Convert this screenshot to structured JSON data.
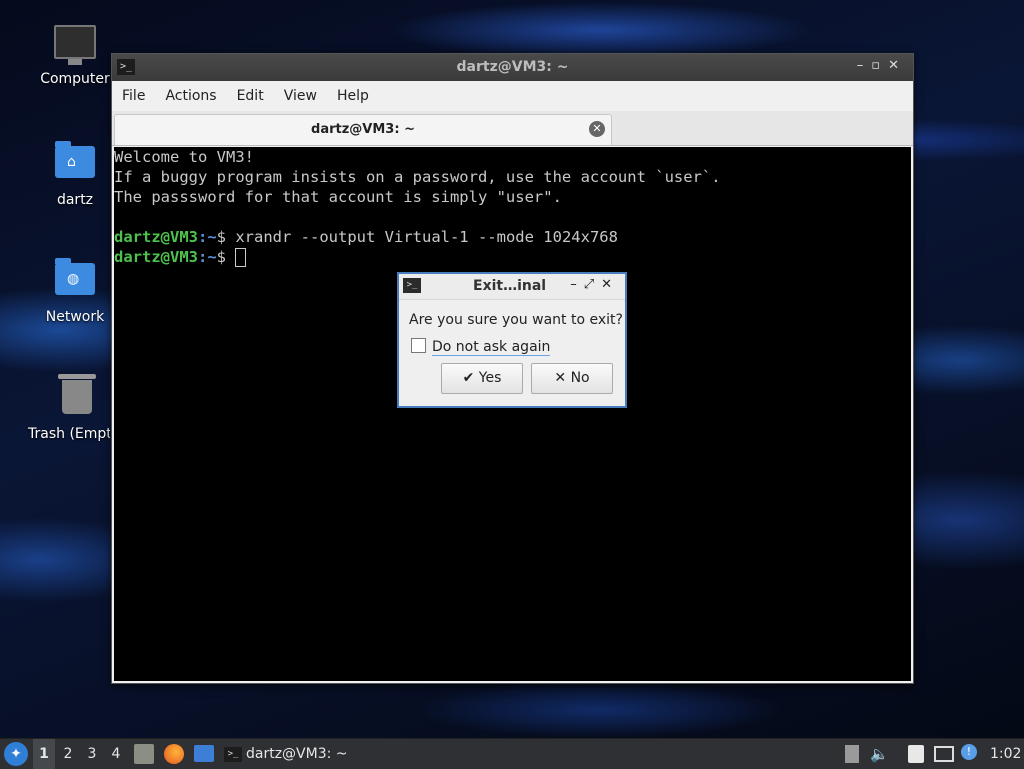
{
  "desktop": {
    "icons": [
      {
        "label": "Computer"
      },
      {
        "label": "dartz"
      },
      {
        "label": "Network"
      },
      {
        "label": "Trash (Empty)"
      }
    ]
  },
  "terminal_window": {
    "title": "dartz@VM3: ~",
    "menu": [
      "File",
      "Actions",
      "Edit",
      "View",
      "Help"
    ],
    "tab_title": "dartz@VM3: ~",
    "lines": [
      "Welcome to VM3!",
      "If a buggy program insists on a password, use the account `user`.",
      "The passsword for that account is simply \"user\"."
    ],
    "prompt_user": "dartz@VM3",
    "prompt_path": ":~",
    "prompt_symbol": "$",
    "command1": " xrandr --output Virtual-1 --mode 1024x768"
  },
  "dialog": {
    "title": "Exit…inal",
    "question": "Are you sure you want to exit?",
    "checkbox_label": "Do not ask again",
    "yes_label": "Yes",
    "no_label": "No"
  },
  "taskbar": {
    "workspaces": [
      "1",
      "2",
      "3",
      "4"
    ],
    "task_label": "dartz@VM3: ~",
    "clock": "1:02"
  }
}
